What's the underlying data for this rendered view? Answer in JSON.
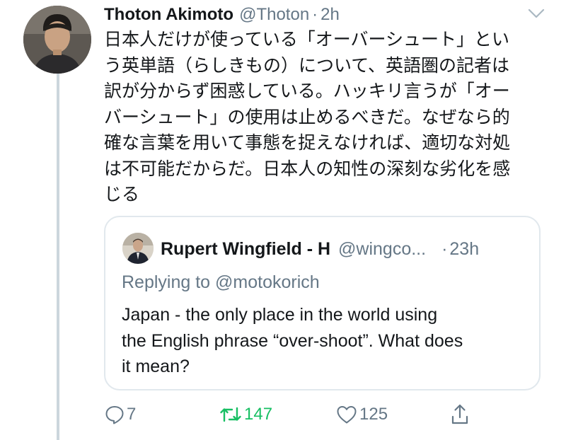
{
  "tweet": {
    "display_name": "Thoton Akimoto",
    "handle": "@Thoton",
    "time": "2h",
    "body_lines": [
      "日本人だけが使っている「オーバーシュート」とい",
      "う英単語（らしきもの）について、英語圏の記者は",
      "訳が分からず困惑している。ハッキリ言うが「オー",
      "バーシュート」の使用は止めるべきだ。なぜなら的",
      "確な言葉を用いて事態を捉えなければ、適切な対処",
      "は不可能だからだ。日本人の知性の深刻な劣化を感",
      "じる"
    ]
  },
  "quoted_tweet": {
    "display_name": "Rupert Wingfield - H",
    "handle": "@wingco...",
    "time": "23h",
    "replying_to": "Replying to @motokorich",
    "body_lines": [
      "Japan - the only place in the world using",
      "the English phrase “over-shoot”. What does",
      "it mean?"
    ]
  },
  "actions": {
    "reply_count": "7",
    "retweet_count": "147",
    "like_count": "125"
  },
  "icons": {
    "more": "chevron-down-icon",
    "reply": "reply-bubble-icon",
    "retweet": "retweet-arrows-icon",
    "like": "heart-outline-icon",
    "share": "share-upload-icon"
  },
  "colors": {
    "text_primary": "#14171a",
    "text_secondary": "#657786",
    "retweet_active": "#17bf63",
    "border": "#e1e8ed",
    "thread_line": "#ccd6dd"
  }
}
